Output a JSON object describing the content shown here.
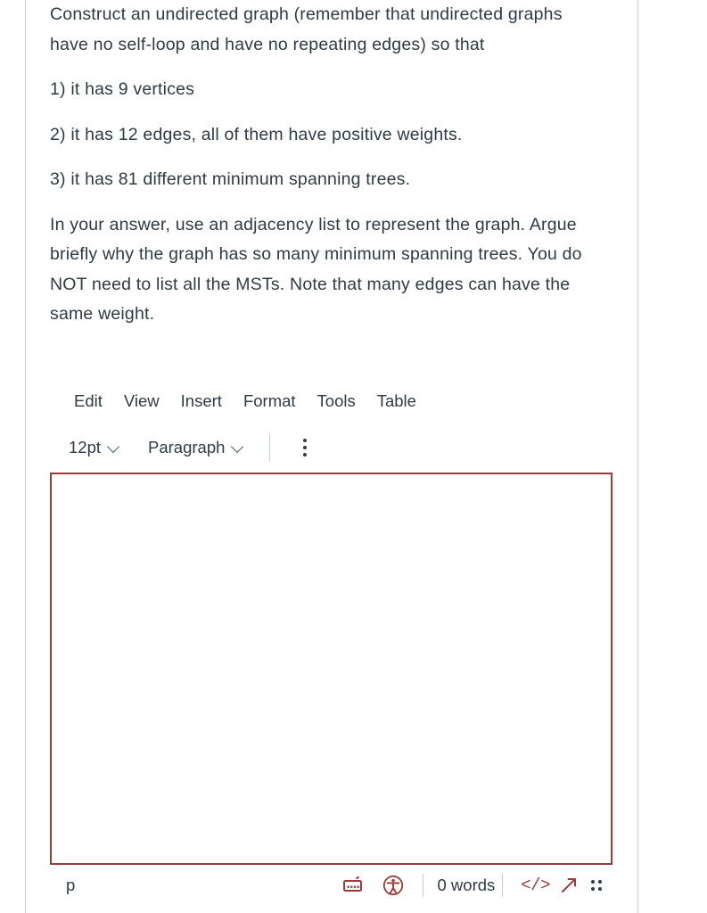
{
  "question": {
    "paragraphs": [
      "Construct an undirected graph (remember that undirected graphs have no self-loop and have no repeating edges) so that",
      "1) it has 9 vertices",
      "2) it has 12 edges, all of them have positive weights.",
      "3) it has 81 different minimum spanning trees.",
      "In your answer, use an adjacency list to represent the graph. Argue briefly why the graph has so many minimum spanning trees. You do NOT  need to list all the MSTs. Note that many edges can have the same weight."
    ]
  },
  "editor": {
    "menubar": [
      {
        "label": "Edit"
      },
      {
        "label": "View"
      },
      {
        "label": "Insert"
      },
      {
        "label": "Format"
      },
      {
        "label": "Tools"
      },
      {
        "label": "Table"
      }
    ],
    "toolbar": {
      "font_size": "12pt",
      "block_format": "Paragraph",
      "overflow_label": "More options"
    },
    "content": "",
    "placeholder": "",
    "border_color": "#9b3a3a"
  },
  "statusbar": {
    "element_path": "p",
    "keyboard_shortcuts_label": "Keyboard shortcuts",
    "accessibility_label": "Accessibility checker",
    "word_count": "0 words",
    "html_editor_label": "</>",
    "fullscreen_label": "Fullscreen",
    "resize_handle_label": "Resize"
  },
  "colors": {
    "text": "#2d3b45",
    "accent": "#9b3a3a",
    "rule": "#c7cdd1"
  }
}
